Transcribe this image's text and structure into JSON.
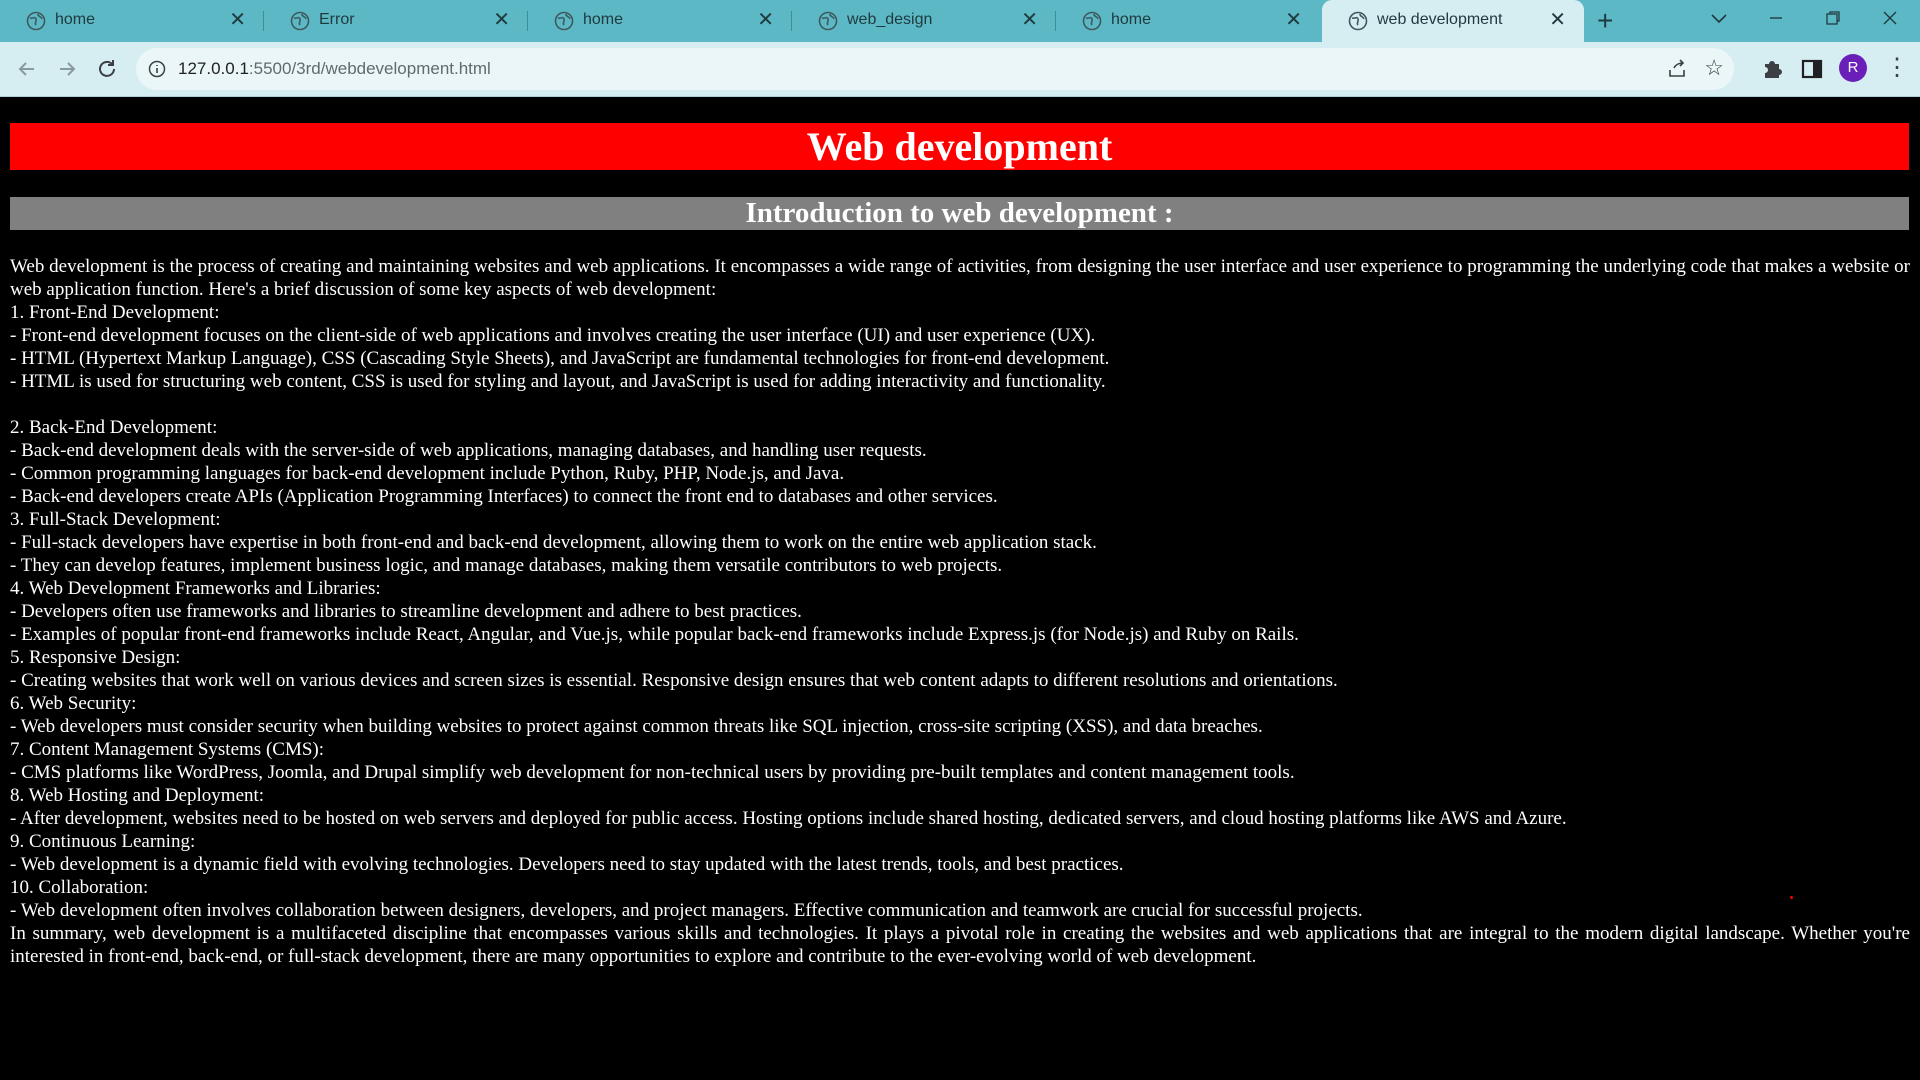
{
  "tabs": [
    {
      "title": "home"
    },
    {
      "title": "Error"
    },
    {
      "title": "home"
    },
    {
      "title": "web_design"
    },
    {
      "title": "home"
    },
    {
      "title": "web development",
      "active": true
    }
  ],
  "address_bar": {
    "url_host": "127.0.0.1",
    "url_rest": ":5500/3rd/webdevelopment.html"
  },
  "profile": {
    "initial": "R",
    "color": "#6a1fb8"
  },
  "icons": {
    "back": "arrow-left-icon",
    "forward": "arrow-right-icon",
    "reload": "reload-icon",
    "site_info": "info-icon",
    "share": "share-icon",
    "bookmark": "star-icon",
    "extensions": "puzzle-icon",
    "side_panel": "side-panel-icon",
    "menu": "kebab-menu-icon",
    "tab_favicon": "globe-icon",
    "new_tab": "plus-icon",
    "tab_search": "chevron-down-icon",
    "minimize": "minimize-icon",
    "restore": "restore-icon",
    "close_window": "close-icon"
  },
  "page": {
    "heading": "Web development",
    "subheading": "Introduction to web development :",
    "heading_bg": "#ff0000",
    "subheading_bg": "#808080",
    "body": "Web development is the process of creating and maintaining websites and web applications. It encompasses a wide range of activities, from designing the user interface and user experience to programming the underlying code that makes a website or web application function. Here's a brief discussion of some key aspects of web development:\n1. Front-End Development:\n- Front-end development focuses on the client-side of web applications and involves creating the user interface (UI) and user experience (UX).\n- HTML (Hypertext Markup Language), CSS (Cascading Style Sheets), and JavaScript are fundamental technologies for front-end development.\n- HTML is used for structuring web content, CSS is used for styling and layout, and JavaScript is used for adding interactivity and functionality.\n\n2. Back-End Development:\n- Back-end development deals with the server-side of web applications, managing databases, and handling user requests.\n- Common programming languages for back-end development include Python, Ruby, PHP, Node.js, and Java.\n- Back-end developers create APIs (Application Programming Interfaces) to connect the front end to databases and other services.\n3. Full-Stack Development:\n- Full-stack developers have expertise in both front-end and back-end development, allowing them to work on the entire web application stack.\n- They can develop features, implement business logic, and manage databases, making them versatile contributors to web projects.\n4. Web Development Frameworks and Libraries:\n- Developers often use frameworks and libraries to streamline development and adhere to best practices.\n- Examples of popular front-end frameworks include React, Angular, and Vue.js, while popular back-end frameworks include Express.js (for Node.js) and Ruby on Rails.\n5. Responsive Design:\n- Creating websites that work well on various devices and screen sizes is essential. Responsive design ensures that web content adapts to different resolutions and orientations.\n6. Web Security:\n- Web developers must consider security when building websites to protect against common threats like SQL injection, cross-site scripting (XSS), and data breaches.\n7. Content Management Systems (CMS):\n- CMS platforms like WordPress, Joomla, and Drupal simplify web development for non-technical users by providing pre-built templates and content management tools.\n8. Web Hosting and Deployment:\n- After development, websites need to be hosted on web servers and deployed for public access. Hosting options include shared hosting, dedicated servers, and cloud hosting platforms like AWS and Azure.\n9. Continuous Learning:\n- Web development is a dynamic field with evolving technologies. Developers need to stay updated with the latest trends, tools, and best practices.\n10. Collaboration:\n- Web development often involves collaboration between designers, developers, and project managers. Effective communication and teamwork are crucial for successful projects.\nIn summary, web development is a multifaceted discipline that encompasses various skills and technologies. It plays a pivotal role in creating the websites and web applications that are integral to the modern digital landscape. Whether you're interested in front-end, back-end, or full-stack development, there are many opportunities to explore and contribute to the ever-evolving world of web development."
  }
}
